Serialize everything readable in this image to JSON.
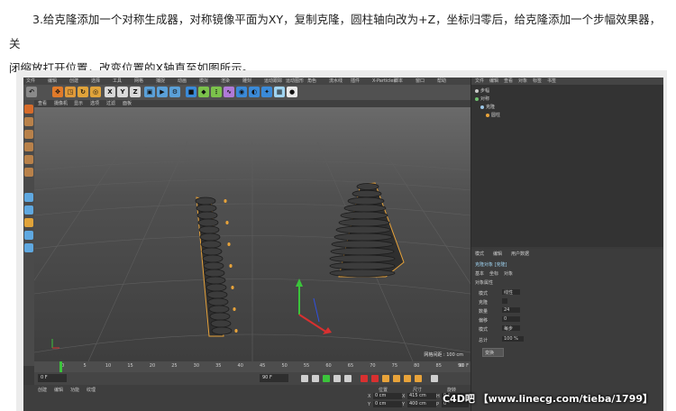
{
  "caption": {
    "line1": "3.给克隆添加一个对称生成器，对称镜像平面为XY，复制克隆，圆柱轴向改为+Z，坐标归零后，给克隆添加一个步幅效果器，关",
    "line2": "闭缩放打开位置，改变位置的X轴直至如图所示。"
  },
  "app": {
    "menu": [
      "文件",
      "编辑",
      "创建",
      "选择",
      "工具",
      "网格",
      "捕捉",
      "动画",
      "模拟",
      "渲染",
      "雕刻",
      "运动跟踪",
      "运动图形",
      "角色",
      "流水线",
      "插件",
      "X-Particles",
      "脚本",
      "窗口",
      "帮助"
    ],
    "toolbar_axes": [
      "X",
      "Y",
      "Z"
    ],
    "viewport_menu": [
      "查看",
      "摄像机",
      "显示",
      "选项",
      "过滤",
      "面板"
    ],
    "viewport_status": "网格间距 : 100 cm",
    "timeline": {
      "ticks": [
        "0",
        "5",
        "10",
        "15",
        "20",
        "25",
        "30",
        "35",
        "40",
        "45",
        "50",
        "55",
        "60",
        "65",
        "70",
        "75",
        "80",
        "85",
        "90"
      ],
      "end_frame": "90 F",
      "current_frame": "0 F",
      "field_a": "0 F",
      "field_b": "90 F"
    },
    "bottom_tabs": [
      "创建",
      "编辑",
      "功能",
      "纹理"
    ],
    "coords": {
      "headers": [
        "位置",
        "尺寸",
        "旋转"
      ],
      "rows": [
        [
          "X",
          "0 cm",
          "X",
          "415 cm",
          "H",
          "0 °"
        ],
        [
          "Y",
          "0 cm",
          "Y",
          "400 cm",
          "P",
          "0 °"
        ]
      ]
    },
    "objects": {
      "header": [
        "文件",
        "编辑",
        "查看",
        "对象",
        "标签",
        "书签"
      ],
      "rows": [
        {
          "name": "步幅",
          "color": "#c9c9c9"
        },
        {
          "name": "对称",
          "color": "#6fbf6f"
        },
        {
          "name": "克隆",
          "color": "#9cc7e8"
        },
        {
          "name": "圆柱",
          "color": "#e8a33a"
        }
      ]
    },
    "attributes": {
      "tabs": [
        "模式",
        "编辑",
        "用户数据"
      ],
      "object_title": "克隆对象 [克隆]",
      "subtabs": [
        "基本",
        "坐标",
        "对象"
      ],
      "section": "对象属性",
      "rows": [
        {
          "label": "模式",
          "value": "线性"
        },
        {
          "label": "克隆",
          "value": ""
        },
        {
          "label": "数量",
          "value": "24"
        },
        {
          "label": "偏移",
          "value": "0"
        },
        {
          "label": "模式",
          "value": "每步"
        },
        {
          "label": "总计",
          "value": "100 %"
        }
      ],
      "button": "变换"
    },
    "colors": {
      "bg": "#3a3a3a",
      "viewport": "#4b4b4b",
      "accent_orange": "#e8a33a",
      "axis_green": "#3bc43b",
      "axis_red": "#d83030",
      "axis_blue": "#3050e0"
    }
  },
  "watermark": "C4D吧 【www.linecg.com/tieba/1799】"
}
